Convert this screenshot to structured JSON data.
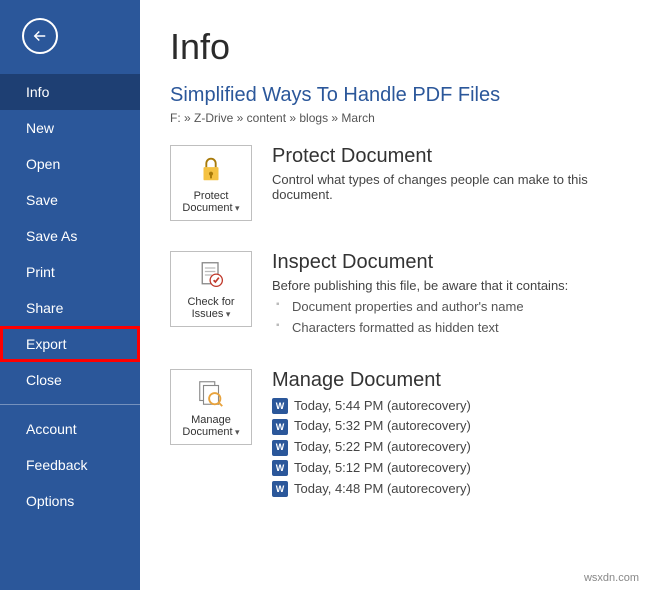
{
  "sidebar": {
    "items": [
      {
        "label": "Info",
        "selected": true,
        "highlight": false
      },
      {
        "label": "New",
        "selected": false,
        "highlight": false
      },
      {
        "label": "Open",
        "selected": false,
        "highlight": false
      },
      {
        "label": "Save",
        "selected": false,
        "highlight": false
      },
      {
        "label": "Save As",
        "selected": false,
        "highlight": false
      },
      {
        "label": "Print",
        "selected": false,
        "highlight": false
      },
      {
        "label": "Share",
        "selected": false,
        "highlight": false
      },
      {
        "label": "Export",
        "selected": false,
        "highlight": true
      },
      {
        "label": "Close",
        "selected": false,
        "highlight": false
      }
    ],
    "footer_items": [
      {
        "label": "Account"
      },
      {
        "label": "Feedback"
      },
      {
        "label": "Options"
      }
    ]
  },
  "main": {
    "page_title": "Info",
    "doc_title": "Simplified Ways To Handle PDF Files",
    "breadcrumb": "F: » Z-Drive » content » blogs » March",
    "sections": {
      "protect": {
        "button_line1": "Protect",
        "button_line2": "Document",
        "heading": "Protect Document",
        "desc": "Control what types of changes people can make to this document."
      },
      "inspect": {
        "button_line1": "Check for",
        "button_line2": "Issues",
        "heading": "Inspect Document",
        "desc": "Before publishing this file, be aware that it contains:",
        "bullets": [
          "Document properties and author's name",
          "Characters formatted as hidden text"
        ]
      },
      "manage": {
        "button_line1": "Manage",
        "button_line2": "Document",
        "heading": "Manage Document",
        "items": [
          "Today, 5:44 PM (autorecovery)",
          "Today, 5:32 PM (autorecovery)",
          "Today, 5:22 PM (autorecovery)",
          "Today, 5:12 PM (autorecovery)",
          "Today, 4:48 PM (autorecovery)"
        ]
      }
    }
  },
  "footer_credit": "wsxdn.com"
}
